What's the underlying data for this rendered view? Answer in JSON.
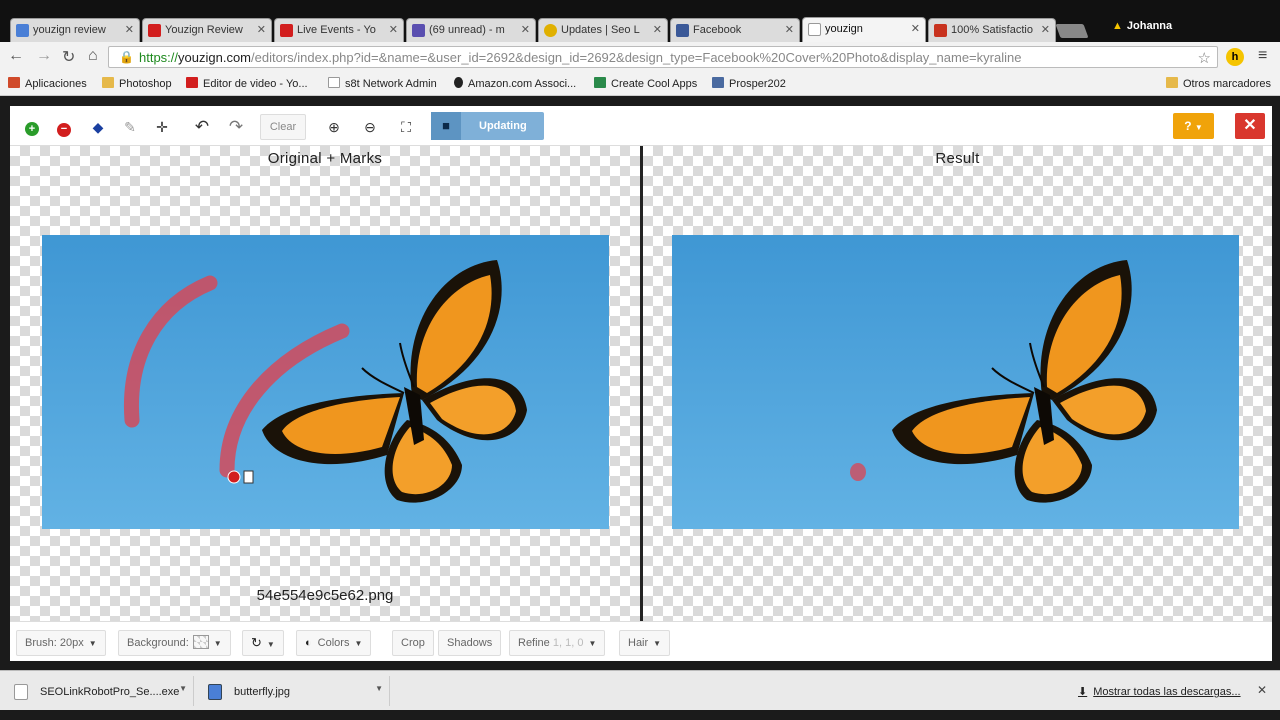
{
  "browser": {
    "tabs": [
      {
        "title": "youzign review",
        "favicon": "google-icon",
        "color": "#4a7fd6",
        "active": false
      },
      {
        "title": "Youzign Review",
        "favicon": "youtube-icon",
        "color": "#d21e1e",
        "active": false
      },
      {
        "title": "Live Events - Yo",
        "favicon": "youtube-icon",
        "color": "#d21e1e",
        "active": false
      },
      {
        "title": "(69 unread) - m",
        "favicon": "mail-icon",
        "color": "#5a4fb0",
        "active": false
      },
      {
        "title": "Updates | Seo L",
        "favicon": "seo-icon",
        "color": "#e0b000",
        "active": false
      },
      {
        "title": "Facebook",
        "favicon": "facebook-icon",
        "color": "#3b5998",
        "active": false
      },
      {
        "title": "youzign",
        "favicon": "page-icon",
        "color": "#ffffff",
        "active": true
      },
      {
        "title": "100% Satisfactio",
        "favicon": "satisfaction-icon",
        "color": "#c8321e",
        "active": false
      }
    ],
    "user_name": "Johanna",
    "url_protocol": "https://",
    "url_host": "youzign.com",
    "url_rest": "/editors/index.php?id=&name=&user_id=2692&design_id=2692&design_type=Facebook%20Cover%20Photo&display_name=kyraline",
    "extension_label": "h",
    "bookmarks": [
      {
        "label": "Aplicaciones",
        "icon": "apps-icon",
        "color": "#d04a2a"
      },
      {
        "label": "Photoshop",
        "icon": "folder-icon",
        "color": "#e6b94a"
      },
      {
        "label": "Editor de video - Yo...",
        "icon": "youtube-icon",
        "color": "#d21e1e"
      },
      {
        "label": "s8t Network Admin",
        "icon": "page-icon",
        "color": "#ffffff"
      },
      {
        "label": "Amazon.com Associ...",
        "icon": "amazon-icon",
        "color": "#222222"
      },
      {
        "label": "Create Cool Apps",
        "icon": "app-icon",
        "color": "#2a8a4a"
      },
      {
        "label": "Prosper202",
        "icon": "prosper-icon",
        "color": "#4a6aa0"
      }
    ],
    "other_bookmarks": "Otros marcadores"
  },
  "editor": {
    "clear_label": "Clear",
    "updating_label": "Updating",
    "help_label": "?",
    "left_title": "Original + Marks",
    "right_title": "Result",
    "filename": "54e554e9c5e62.png",
    "bottom": {
      "brush": "Brush: 20px",
      "background": "Background:",
      "colors": "Colors",
      "crop": "Crop",
      "shadows": "Shadows",
      "refine": "Refine",
      "refine_value": "1, 1, 0",
      "hair": "Hair"
    },
    "colors": {
      "sky": "#4aa3d9",
      "wing_orange": "#f0961e",
      "wing_black": "#1a1208",
      "mark_red": "#d44a5a",
      "help": "#f0a30a",
      "close": "#d9372e",
      "save": "#7fb0d8"
    }
  },
  "downloads": {
    "items": [
      {
        "label": "SEOLinkRobotPro_Se....exe",
        "icon": "exe-icon"
      },
      {
        "label": "butterfly.jpg",
        "icon": "image-icon"
      }
    ],
    "show_all": "Mostrar todas las descargas..."
  }
}
